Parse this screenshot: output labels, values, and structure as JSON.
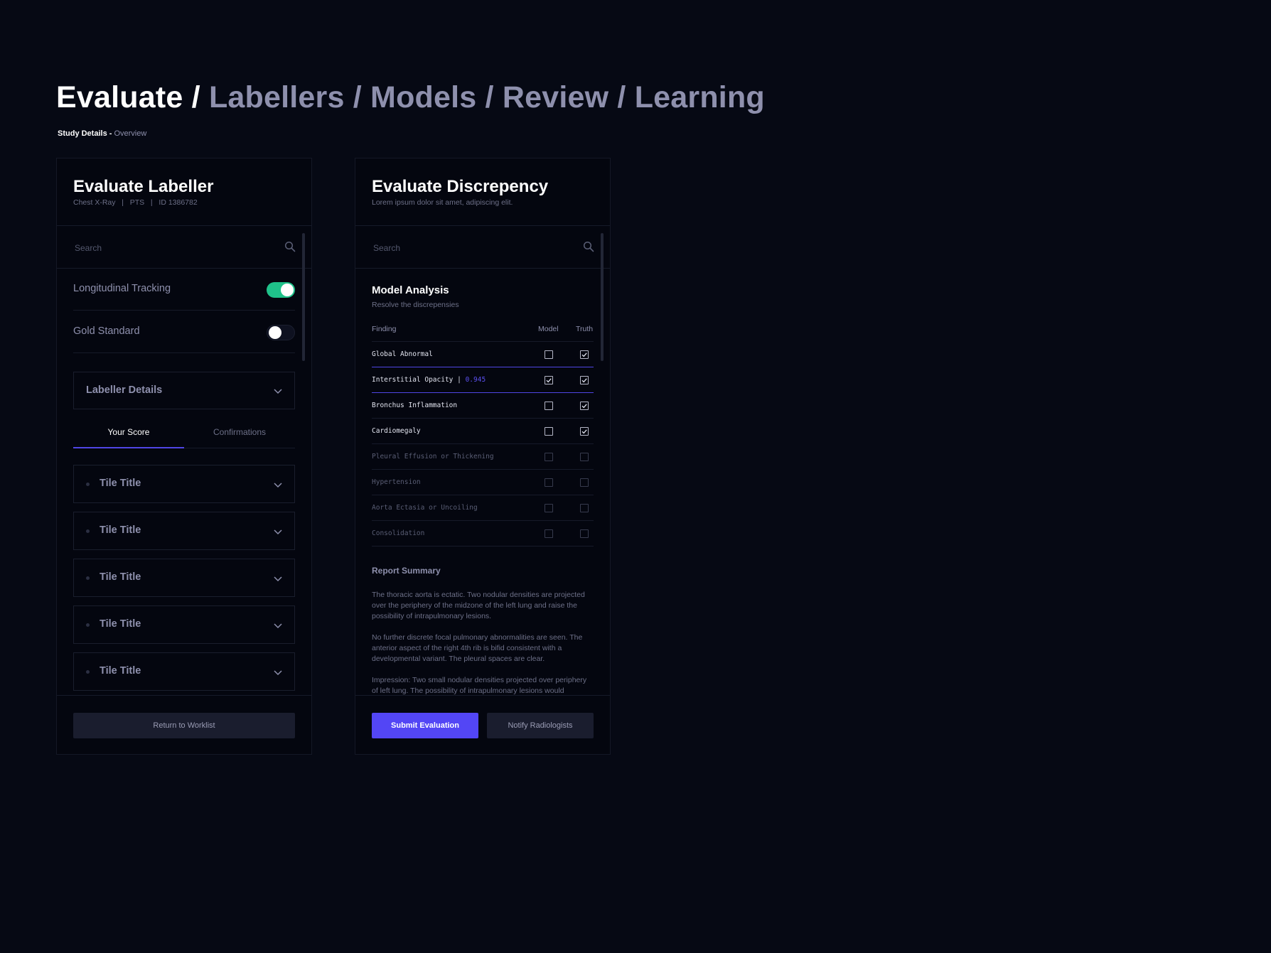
{
  "breadcrumb": {
    "items": [
      "Evaluate",
      "Labellers",
      "Models",
      "Review",
      "Learning"
    ],
    "separator": "/"
  },
  "subcrumb": {
    "strong": "Study Details -",
    "dim": "Overview"
  },
  "left_panel": {
    "title": "Evaluate Labeller",
    "subtitle": "Chest X-Ray   |   PTS   |   ID 1386782",
    "search": {
      "placeholder": "Search",
      "value": ""
    },
    "toggles": [
      {
        "label": "Longitudinal Tracking",
        "on": true
      },
      {
        "label": "Gold Standard",
        "on": false
      }
    ],
    "dropdown": {
      "label": "Labeller Details"
    },
    "tabs": [
      {
        "label": "Your Score",
        "active": true
      },
      {
        "label": "Confirmations",
        "active": false
      }
    ],
    "tiles": [
      {
        "label": "Tile Title"
      },
      {
        "label": "Tile Title"
      },
      {
        "label": "Tile Title"
      },
      {
        "label": "Tile Title"
      },
      {
        "label": "Tile Title"
      }
    ],
    "footer": {
      "return_label": "Return to Worklist"
    }
  },
  "right_panel": {
    "title": "Evaluate Discrepency",
    "subtitle": "Lorem ipsum dolor sit amet, adipiscing elit.",
    "search": {
      "placeholder": "Search",
      "value": ""
    },
    "analysis": {
      "title": "Model Analysis",
      "subtitle": "Resolve the discrepensies",
      "columns": {
        "finding": "Finding",
        "model": "Model",
        "truth": "Truth"
      },
      "rows": [
        {
          "finding": "Global Abnormal",
          "score": "",
          "model": false,
          "truth": true,
          "dim": false
        },
        {
          "finding": "Interstitial Opacity",
          "score": "0.945",
          "model": true,
          "truth": true,
          "dim": false
        },
        {
          "finding": "Bronchus Inflammation",
          "score": "",
          "model": false,
          "truth": true,
          "dim": false
        },
        {
          "finding": "Cardiomegaly",
          "score": "",
          "model": false,
          "truth": true,
          "dim": false
        },
        {
          "finding": "Pleural Effusion or Thickening",
          "score": "",
          "model": false,
          "truth": false,
          "dim": true
        },
        {
          "finding": "Hypertension",
          "score": "",
          "model": false,
          "truth": false,
          "dim": true
        },
        {
          "finding": "Aorta Ectasia or Uncoiling",
          "score": "",
          "model": false,
          "truth": false,
          "dim": true
        },
        {
          "finding": "Consolidation",
          "score": "",
          "model": false,
          "truth": false,
          "dim": true
        }
      ]
    },
    "report": {
      "title": "Report Summary",
      "paragraphs": [
        "The thoracic aorta is ectatic. Two nodular densities are projected over the periphery of the midzone of the left lung and raise the possibility of intrapulmonary lesions.",
        "No further discrete focal pulmonary abnormalities are seen. The anterior aspect of the right 4th rib is bifid consistent with a developmental variant. The pleural spaces are clear.",
        "Impression: Two small nodular densities projected over periphery of left lung. The possibility of intrapulmonary lesions would"
      ]
    },
    "footer": {
      "submit_label": "Submit Evaluation",
      "notify_label": "Notify Radiologists"
    }
  },
  "colors": {
    "accent": "#5346f5",
    "toggle_on": "#1fc28a",
    "background": "#060914"
  }
}
